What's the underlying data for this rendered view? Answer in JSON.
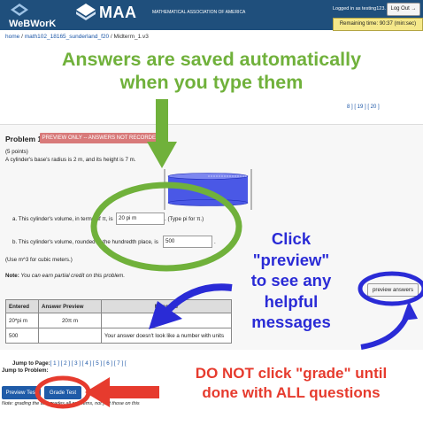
{
  "header": {
    "logo_text": "WeBWorK",
    "maa_title": "MAA",
    "maa_subtitle": "MATHEMATICAL ASSOCIATION OF AMERICA",
    "login_text": "Logged in as testing123.",
    "logout_label": "Log Out",
    "timer_text": "Remaining time: 90:37 (min:sec)",
    "colors": {
      "header_bg": "#1f4f7c",
      "timer_bg": "#f5e88a"
    }
  },
  "breadcrumb": {
    "home": "home",
    "course": "math102_18165_sunderland_f20",
    "set": "Midterm_1.v3",
    "separator": " / "
  },
  "annotations": {
    "top_note_line1": "Answers are saved automatically",
    "top_note_line2": "when you type them",
    "click_line1": "Click",
    "click_line2": "\"preview\"",
    "click_line3": "to see any",
    "click_line4": "helpful",
    "click_line5": "messages",
    "grade_line1": "DO NOT click \"grade\" until",
    "grade_line2": "done with ALL questions",
    "colors": {
      "green": "#70b13b",
      "blue": "#2a2bd6",
      "red": "#e63b2e"
    }
  },
  "pages_top": "8 ] [ 19 ] [ 20 ]",
  "problem": {
    "title": "Problem 1.",
    "preview_only": "PREVIEW ONLY -- ANSWERS NOT RECORDED",
    "points": "(5 points)",
    "text": "A cylinder's base's radius is 2 m, and its height is 7 m.",
    "part_a_label": "a. This cylinder's volume, in terms of π, is",
    "part_a_value": "20 pi m",
    "part_a_hint": ". (Type pi for π.)",
    "part_b_label": "b. This cylinder's volume, rounded to the hundredth place, is",
    "part_b_value": "500",
    "part_b_end": ".",
    "units_note": "(Use m^3 for cubic meters.)",
    "credit_note_bold": "Note:",
    "credit_note": " You can earn partial credit on this problem.",
    "preview_button": "preview answers"
  },
  "results_table": {
    "headers": [
      "Entered",
      "Answer Preview",
      "Message"
    ],
    "rows": [
      [
        "20*pi m",
        "20π m",
        ""
      ],
      [
        "500",
        "",
        "Your answer doesn't look like a number with units"
      ]
    ]
  },
  "jump": {
    "page_label": "Jump to Page:",
    "pages": "[ 1 ] [ 2 ] [ 3 ] [ 4 ] [ 5 ] [ 6 ] [ 7 ] [",
    "problem_label": "Jump to Problem:"
  },
  "buttons": {
    "preview_test": "Preview Test",
    "grade_test": "Grade Test"
  },
  "bottom_note": "Note: grading the test grades all problems, not just those on this"
}
